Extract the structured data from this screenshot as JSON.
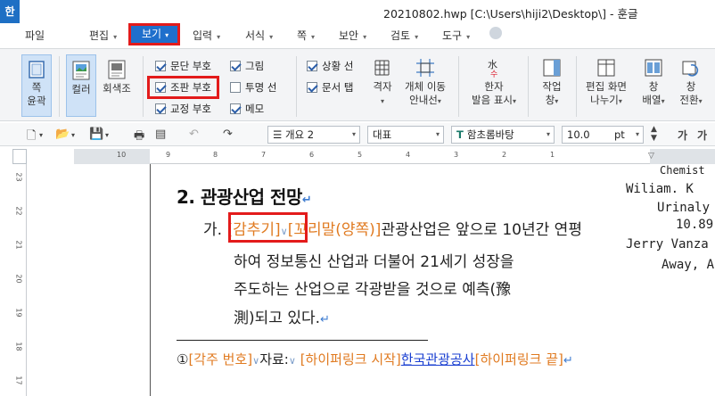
{
  "window": {
    "app_icon": "한",
    "title": "20210802.hwp [C:\\Users\\hiji2\\Desktop\\] - 훈글"
  },
  "menu": {
    "file": "파일",
    "edit": "편집",
    "view": "보기",
    "insert": "입력",
    "format": "서식",
    "page": "쪽",
    "security": "보안",
    "review": "검토",
    "tools": "도구"
  },
  "ribbon": {
    "page_outline_1": "쪽",
    "page_outline_2": "윤곽",
    "color": "컬러",
    "grayscale": "회색조",
    "checks": {
      "paragraph_mark": "문단 부호",
      "layout_mark": "조판 부호",
      "proof_mark": "교정 부호",
      "picture": "그림",
      "transparent_line": "투명 선",
      "memo": "메모",
      "status_line": "상황 선",
      "doc_tab": "문서 탭"
    },
    "check_states": {
      "paragraph_mark": true,
      "layout_mark": true,
      "proof_mark": true,
      "picture": true,
      "transparent_line": false,
      "memo": true,
      "status_line": true,
      "doc_tab": true
    },
    "grid": "격자",
    "object_move_1": "개체 이동",
    "object_move_2": "안내선",
    "hanja_1": "한자",
    "hanja_2": "발음 표시",
    "work_window_1": "작업",
    "work_window_2": "창",
    "split_1": "편집 화면",
    "split_2": "나누기",
    "window_arrange_1": "창",
    "window_arrange_2": "배열",
    "window_switch_1": "창",
    "window_switch_2": "전환"
  },
  "toolbar": {
    "style": "개요 2",
    "font_group": "대표",
    "font_name": "함초롬바탕",
    "font_size": "10.0",
    "font_unit": "pt",
    "char_shape_icon": "가",
    "char_shape_icon2": "가"
  },
  "ruler": {
    "h_numbers": [
      "10",
      "9",
      "8",
      "7",
      "6",
      "5",
      "4",
      "3",
      "2",
      "1"
    ],
    "v_numbers": [
      "23",
      "22",
      "21",
      "20",
      "19",
      "18",
      "17"
    ]
  },
  "document": {
    "heading": "2. 관광산업 전망",
    "line1_prefix": "가.",
    "line1_hide": "[감추기]",
    "line1_tail": "[꼬리말(양쪽)]",
    "line1_text": "관광산업은 앞으로 10년간 연평",
    "line2": "하여 정보통신 산업과 더불어 21세기 성장을",
    "line3": "주도하는 산업으로 각광받을 것으로 예측(豫",
    "line4": "測)되고 있다.",
    "footnote_num": "①",
    "footnote_ctrl": "[각주 번호]",
    "footnote_label": "자료:",
    "hyperlink_start": "[하이퍼링크 시작]",
    "hyperlink_text": "한국관광공사",
    "hyperlink_end": "[하이퍼링크 끝]",
    "side_lines": [
      "Chemist",
      "Wiliam.  K",
      "Urinaly",
      "Jerry  Vanza",
      "Away,  A"
    ],
    "side_overlap": "10.89"
  }
}
